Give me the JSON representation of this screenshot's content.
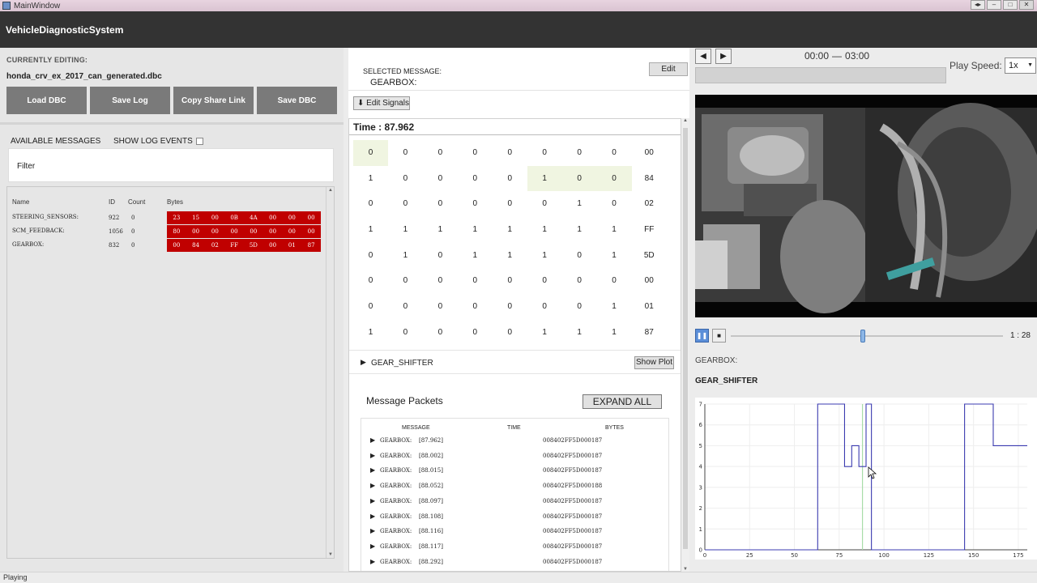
{
  "window": {
    "title": "MainWindow",
    "buttons": [
      "◂▸",
      "–",
      "□",
      "✕"
    ]
  },
  "app": {
    "title": "VehicleDiagnosticSystem"
  },
  "left": {
    "currently_editing_label": "CURRENTLY EDITING:",
    "file_name": "honda_crv_ex_2017_can_generated.dbc",
    "buttons": {
      "load_dbc": "Load DBC",
      "save_log": "Save Log",
      "copy_link": "Copy Share Link",
      "save_dbc": "Save DBC"
    },
    "available_label": "AVAILABLE MESSAGES",
    "show_log_label": "SHOW LOG EVENTS",
    "filter_placeholder": "Filter",
    "columns": {
      "name": "Name",
      "id": "ID",
      "count": "Count",
      "bytes": "Bytes"
    },
    "messages": [
      {
        "name": "STEERING_SENSORS:",
        "id": "922",
        "count": "0",
        "bytes": [
          "23",
          "15",
          "00",
          "0B",
          "4A",
          "00",
          "00",
          "00"
        ]
      },
      {
        "name": "SCM_FEEDBACK:",
        "id": "1056",
        "count": "0",
        "bytes": [
          "80",
          "00",
          "00",
          "00",
          "00",
          "00",
          "00",
          "00"
        ]
      },
      {
        "name": "GEARBOX:",
        "id": "832",
        "count": "0",
        "bytes": [
          "00",
          "84",
          "02",
          "FF",
          "5D",
          "00",
          "01",
          "87"
        ]
      }
    ]
  },
  "status": {
    "text": "Playing"
  },
  "middle": {
    "selected_label": "SELECTED MESSAGE:",
    "selected_name": "GEARBOX:",
    "edit_label": "Edit",
    "edit_signals_label": "⬇ Edit Signals",
    "time_label": "Time : 87.962",
    "bit_rows": [
      {
        "bits": [
          "0",
          "0",
          "0",
          "0",
          "0",
          "0",
          "0",
          "0"
        ],
        "hex": "00",
        "hl": [
          0
        ]
      },
      {
        "bits": [
          "1",
          "0",
          "0",
          "0",
          "0",
          "1",
          "0",
          "0"
        ],
        "hex": "84",
        "hl": [
          5,
          6,
          7
        ]
      },
      {
        "bits": [
          "0",
          "0",
          "0",
          "0",
          "0",
          "0",
          "1",
          "0"
        ],
        "hex": "02",
        "hl": []
      },
      {
        "bits": [
          "1",
          "1",
          "1",
          "1",
          "1",
          "1",
          "1",
          "1"
        ],
        "hex": "FF",
        "hl": []
      },
      {
        "bits": [
          "0",
          "1",
          "0",
          "1",
          "1",
          "1",
          "0",
          "1"
        ],
        "hex": "5D",
        "hl": []
      },
      {
        "bits": [
          "0",
          "0",
          "0",
          "0",
          "0",
          "0",
          "0",
          "0"
        ],
        "hex": "00",
        "hl": []
      },
      {
        "bits": [
          "0",
          "0",
          "0",
          "0",
          "0",
          "0",
          "0",
          "1"
        ],
        "hex": "01",
        "hl": []
      },
      {
        "bits": [
          "1",
          "0",
          "0",
          "0",
          "0",
          "1",
          "1",
          "1"
        ],
        "hex": "87",
        "hl": []
      }
    ],
    "signal_name": "GEAR_SHIFTER",
    "show_plot_label": "Show Plot",
    "packets_title": "Message Packets",
    "expand_all_label": "EXPAND ALL",
    "packet_columns": {
      "message": "MESSAGE",
      "time": "TIME",
      "bytes": "BYTES"
    },
    "packets": [
      {
        "name": "GEARBOX:",
        "time": "[87.962]",
        "bytes": "008402FF5D000187"
      },
      {
        "name": "GEARBOX:",
        "time": "[88.002]",
        "bytes": "008402FF5D000187"
      },
      {
        "name": "GEARBOX:",
        "time": "[88.015]",
        "bytes": "008402FF5D000187"
      },
      {
        "name": "GEARBOX:",
        "time": "[88.052]",
        "bytes": "008402FF5D000188"
      },
      {
        "name": "GEARBOX:",
        "time": "[88.097]",
        "bytes": "008402FF5D000187"
      },
      {
        "name": "GEARBOX:",
        "time": "[88.108]",
        "bytes": "008402FF5D000187"
      },
      {
        "name": "GEARBOX:",
        "time": "[88.116]",
        "bytes": "008402FF5D000187"
      },
      {
        "name": "GEARBOX:",
        "time": "[88.117]",
        "bytes": "008402FF5D000187"
      },
      {
        "name": "GEARBOX:",
        "time": "[88.292]",
        "bytes": "008402FF5D000187"
      }
    ]
  },
  "right": {
    "time_start": "00:00",
    "time_sep": "—",
    "time_end": "03:00",
    "play_speed_label": "Play Speed:",
    "play_speed_value": "1x",
    "seek_time": "1 : 28",
    "seek_fraction": 0.485,
    "gearbox_label": "GEARBOX:",
    "signal_label": "GEAR_SHIFTER"
  },
  "colors": {
    "byte_bg": "#c00000",
    "highlight": "#f0f5e1",
    "plot_line": "#3b3bb0",
    "cursor_line": "#a8dca8"
  },
  "chart_data": {
    "type": "line",
    "title": "",
    "xlabel": "",
    "ylabel": "",
    "xlim": [
      0,
      180
    ],
    "ylim": [
      0,
      7
    ],
    "xticks": [
      0,
      25,
      50,
      75,
      100,
      125,
      150,
      175
    ],
    "yticks": [
      0,
      1,
      2,
      3,
      4,
      5,
      6,
      7
    ],
    "cursor_x": 88,
    "series": [
      {
        "x": [
          0,
          63,
          63,
          78,
          78,
          82,
          82,
          86,
          86,
          90,
          90,
          93,
          93,
          145,
          145,
          161,
          161,
          180
        ],
        "y": [
          0,
          0,
          7,
          7,
          4,
          4,
          5,
          5,
          4,
          4,
          7,
          7,
          0,
          0,
          7,
          7,
          5,
          5
        ]
      }
    ]
  }
}
